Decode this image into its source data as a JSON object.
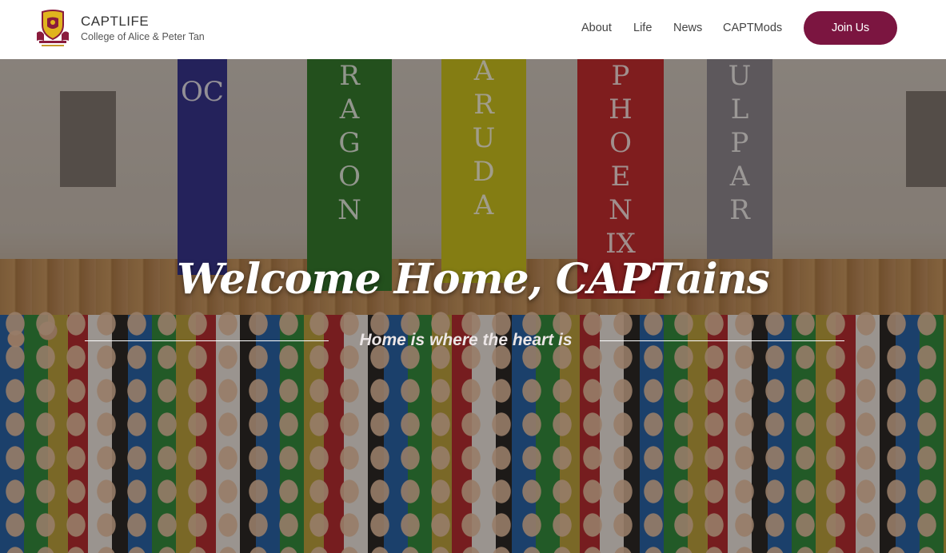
{
  "header": {
    "logo_icon": "college-crest-icon",
    "title": "CAPTLIFE",
    "subtitle": "College of Alice & Peter Tan"
  },
  "nav": {
    "items": [
      {
        "label": "About"
      },
      {
        "label": "Life"
      },
      {
        "label": "News"
      },
      {
        "label": "CAPTMods"
      }
    ],
    "cta_label": "Join Us",
    "cta_color": "#7b1540"
  },
  "hero": {
    "title": "Welcome Home, CAPTains",
    "subtitle": "Home is where the heart is",
    "banners": [
      {
        "text": "OC",
        "color": "#2e2f8f"
      },
      {
        "text": "RAGON",
        "color": "#2c7a2a"
      },
      {
        "text": "ARUDA",
        "color": "#c9c21a"
      },
      {
        "text": "PHOENIX",
        "color": "#c0282d"
      },
      {
        "text": "ULPAR",
        "color": "#8a8690"
      }
    ]
  }
}
